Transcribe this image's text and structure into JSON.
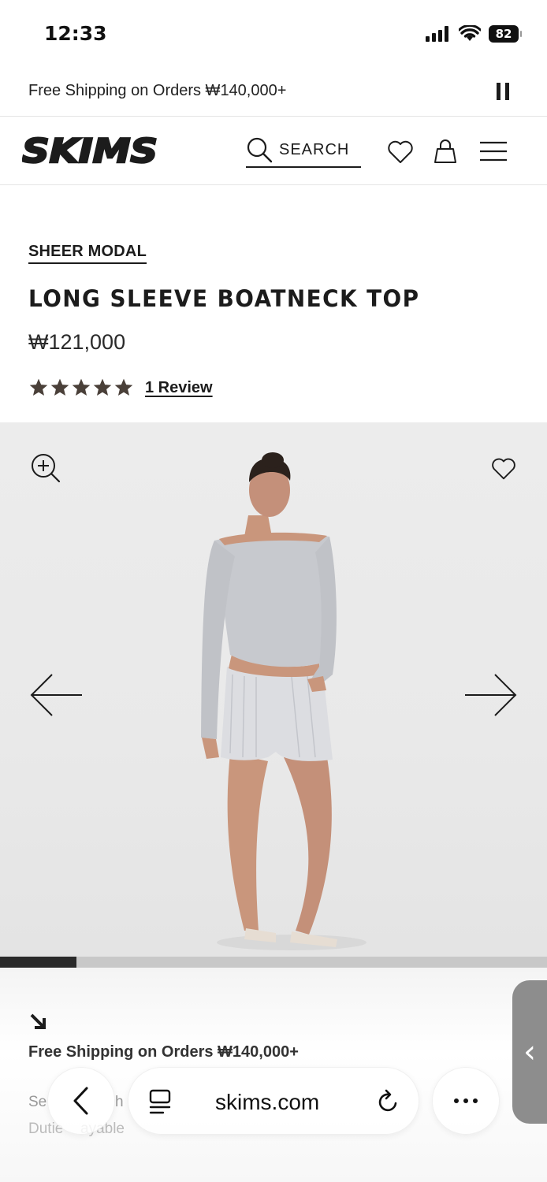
{
  "status_bar": {
    "time": "12:33",
    "battery": "82"
  },
  "promo": {
    "text": "Free Shipping on Orders ₩140,000+"
  },
  "header": {
    "brand": "SKIMS",
    "search_label": "SEARCH"
  },
  "product": {
    "collection": "SHEER MODAL",
    "title": "LONG SLEEVE BOATNECK TOP",
    "price": "₩121,000",
    "rating": 5,
    "review_label": "1 Review"
  },
  "gallery": {
    "progress_fraction": 0.14
  },
  "shipping_info": {
    "title": "Free Shipping on Orders ₩140,000+",
    "line1_fragment": "Se",
    "line1_fragment2": "h",
    "line2_fragment": "Dutie",
    "line2_fragment2": "ayable"
  },
  "browser": {
    "url": "skims.com"
  },
  "colors": {
    "accent": "#1c1c1c",
    "star": "#4a4039",
    "gallery_bg": "#ececec"
  },
  "icons": [
    "signal-icon",
    "wifi-icon",
    "battery-icon",
    "pause-icon",
    "search-icon",
    "heart-icon",
    "bag-icon",
    "menu-icon",
    "zoom-in-icon",
    "arrow-left-icon",
    "arrow-right-icon",
    "diagonal-arrow-icon",
    "chevron-left-icon",
    "tabs-icon",
    "reload-icon",
    "more-icon"
  ]
}
